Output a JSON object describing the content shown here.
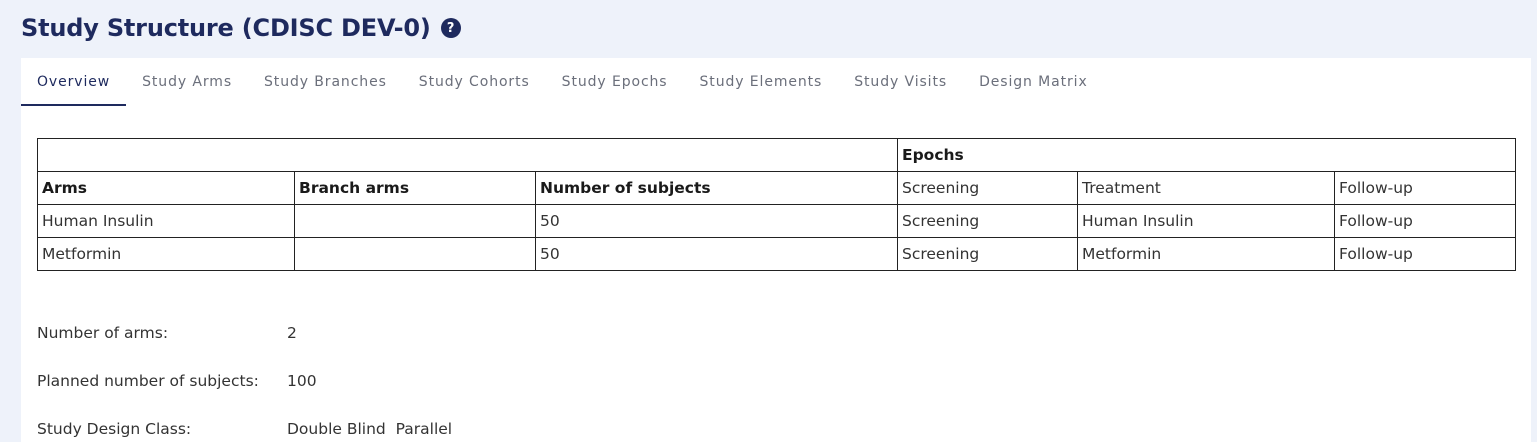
{
  "header": {
    "title": "Study Structure (CDISC DEV-0)",
    "help_glyph": "?"
  },
  "tabs": [
    {
      "label": "Overview",
      "active": true
    },
    {
      "label": "Study Arms",
      "active": false
    },
    {
      "label": "Study Branches",
      "active": false
    },
    {
      "label": "Study Cohorts",
      "active": false
    },
    {
      "label": "Study Epochs",
      "active": false
    },
    {
      "label": "Study Elements",
      "active": false
    },
    {
      "label": "Study Visits",
      "active": false
    },
    {
      "label": "Design Matrix",
      "active": false
    }
  ],
  "table": {
    "epochs_label": "Epochs",
    "columns": [
      "Arms",
      "Branch arms",
      "Number of subjects",
      "Screening",
      "Treatment",
      "Follow-up"
    ],
    "rows": [
      [
        "Human Insulin",
        "",
        "50",
        "Screening",
        "Human Insulin",
        "Follow-up"
      ],
      [
        "Metformin",
        "",
        "50",
        "Screening",
        "Metformin",
        "Follow-up"
      ]
    ]
  },
  "summary": [
    {
      "label": "Number of arms:",
      "value": "2"
    },
    {
      "label": "Planned number of subjects:",
      "value": "100"
    },
    {
      "label": "Study Design Class:",
      "value": "Double Blind  Parallel"
    }
  ],
  "colors": {
    "page_background": "#eef2fa",
    "accent": "#1e2a5e",
    "tab_inactive": "#6b6f7b"
  }
}
